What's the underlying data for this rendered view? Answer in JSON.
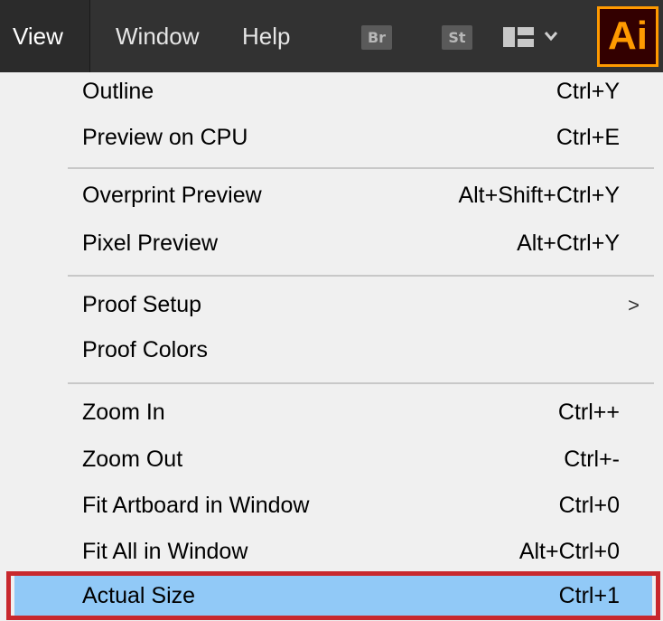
{
  "menubar": {
    "items": [
      "View",
      "Window",
      "Help"
    ],
    "badges": [
      "Br",
      "St"
    ],
    "logo": "Ai"
  },
  "menu": {
    "items": [
      {
        "label": "Outline",
        "shortcut": "Ctrl+Y"
      },
      {
        "label": "Preview on CPU",
        "shortcut": "Ctrl+E"
      },
      {
        "label": "Overprint Preview",
        "shortcut": "Alt+Shift+Ctrl+Y"
      },
      {
        "label": "Pixel Preview",
        "shortcut": "Alt+Ctrl+Y"
      },
      {
        "label": "Proof Setup",
        "shortcut": "",
        "submenu": true,
        "arrow": ">"
      },
      {
        "label": "Proof Colors",
        "shortcut": ""
      },
      {
        "label": "Zoom In",
        "shortcut": "Ctrl++"
      },
      {
        "label": "Zoom Out",
        "shortcut": "Ctrl+-"
      },
      {
        "label": "Fit Artboard in Window",
        "shortcut": "Ctrl+0"
      },
      {
        "label": "Fit All in Window",
        "shortcut": "Alt+Ctrl+0"
      },
      {
        "label": "Actual Size",
        "shortcut": "Ctrl+1",
        "highlighted": true
      }
    ]
  },
  "colors": {
    "menubar_bg": "#323232",
    "menu_bg": "#f0f0f0",
    "highlight_bg": "#91c9f7",
    "annotation_border": "#c8282d",
    "ai_logo_orange": "#ff9a00",
    "ai_logo_bg": "#330000"
  },
  "icons": {
    "workspace_switcher": "workspace-layout-icon",
    "chevron": "chevron-down-icon",
    "submenu": "chevron-right-icon"
  }
}
